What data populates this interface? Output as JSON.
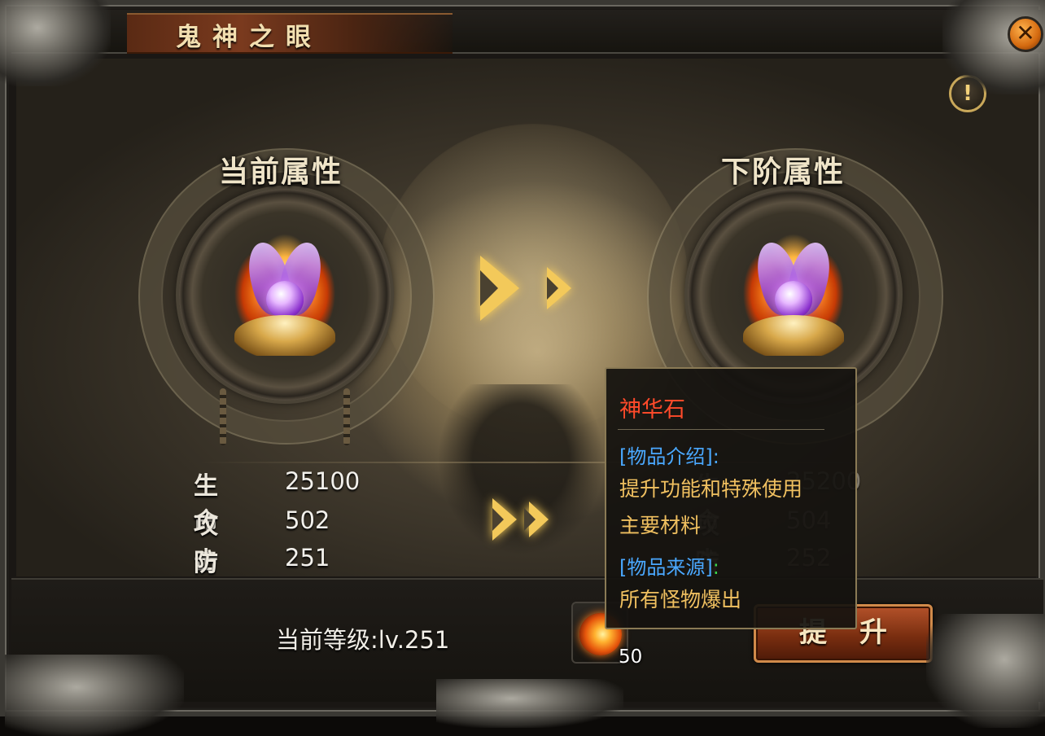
{
  "window": {
    "title": "鬼神之眼",
    "close_icon": "✕",
    "info_icon": "!"
  },
  "current": {
    "header": "当前属性",
    "stats": [
      {
        "label": "生命",
        "value": "25100"
      },
      {
        "label": "攻击",
        "value": "502"
      },
      {
        "label": "防御",
        "value": "251"
      }
    ]
  },
  "next": {
    "header": "下阶属性",
    "stats": [
      {
        "label": "生命",
        "value": "25200"
      },
      {
        "label": "攻击",
        "value": "504"
      },
      {
        "label": "防御",
        "value": "252"
      }
    ]
  },
  "footer": {
    "level_text": "当前等级:lv.251",
    "material_count": "50",
    "upgrade_label": "提升"
  },
  "tooltip": {
    "item_name": "神华石",
    "intro_header": "[物品介绍]:",
    "intro_line1": "提升功能和特殊使用",
    "intro_line2": "主要材料",
    "source_header": "[物品来源]",
    "source_colon": ":",
    "source_text": "所有怪物爆出"
  },
  "colors": {
    "item_name": "#ff4a2a",
    "tooltip_header": "#4aa8ff",
    "tooltip_body": "#f0c060",
    "button": "#b4522a",
    "accent_gold": "#f3c95a"
  }
}
